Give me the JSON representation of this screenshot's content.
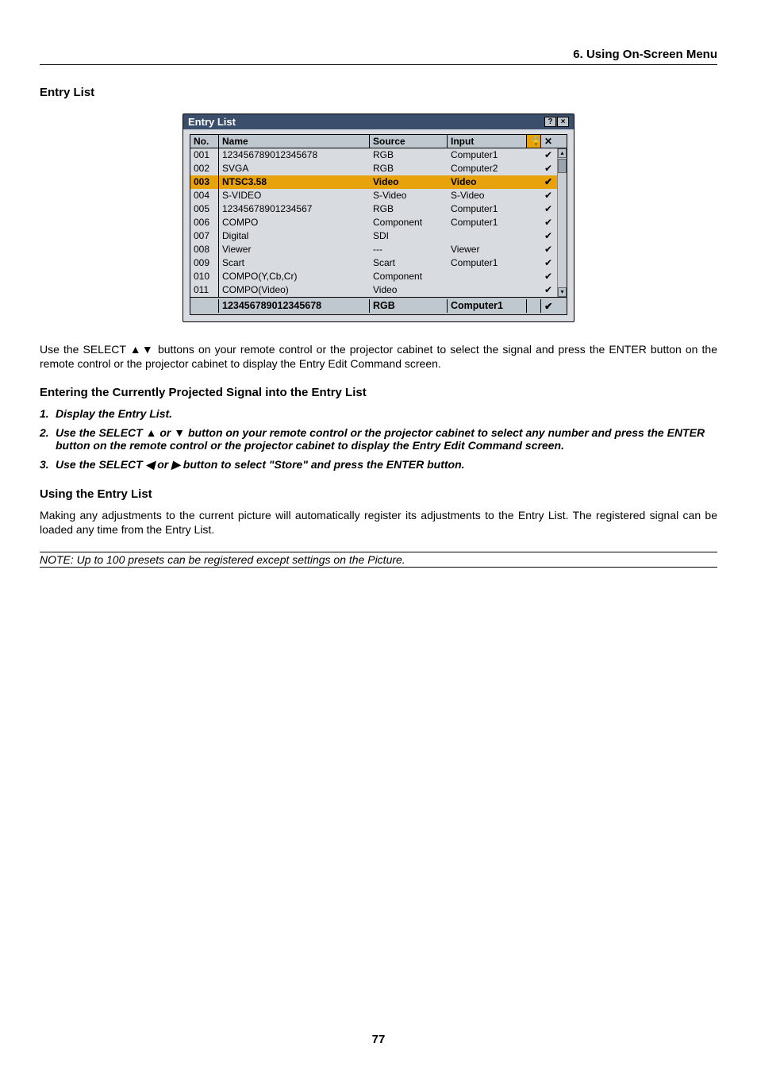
{
  "chapter": "6. Using On-Screen Menu",
  "section_title": "Entry List",
  "dialog": {
    "title": "Entry List",
    "headers": {
      "no": "No.",
      "name": "Name",
      "source": "Source",
      "input": "Input"
    },
    "rows": [
      {
        "no": "001",
        "name": "123456789012345678",
        "source": "RGB",
        "input": "Computer1",
        "check": true,
        "hl": false
      },
      {
        "no": "002",
        "name": "SVGA",
        "source": "RGB",
        "input": "Computer2",
        "check": true,
        "hl": false
      },
      {
        "no": "003",
        "name": "NTSC3.58",
        "source": "Video",
        "input": "Video",
        "check": true,
        "hl": true
      },
      {
        "no": "004",
        "name": "S-VIDEO",
        "source": "S-Video",
        "input": "S-Video",
        "check": true,
        "hl": false
      },
      {
        "no": "005",
        "name": "12345678901234567",
        "source": "RGB",
        "input": "Computer1",
        "check": true,
        "hl": false
      },
      {
        "no": "006",
        "name": "COMPO",
        "source": "Component",
        "input": "Computer1",
        "check": true,
        "hl": false
      },
      {
        "no": "007",
        "name": "Digital",
        "source": "SDI",
        "input": "",
        "check": true,
        "hl": false
      },
      {
        "no": "008",
        "name": "Viewer",
        "source": "---",
        "input": "Viewer",
        "check": true,
        "hl": false
      },
      {
        "no": "009",
        "name": "Scart",
        "source": "Scart",
        "input": "Computer1",
        "check": true,
        "hl": false
      },
      {
        "no": "010",
        "name": "COMPO(Y,Cb,Cr)",
        "source": "Component",
        "input": "",
        "check": true,
        "hl": false
      },
      {
        "no": "011",
        "name": "COMPO(Video)",
        "source": "Video",
        "input": "",
        "check": true,
        "hl": false
      }
    ],
    "status": {
      "name": "123456789012345678",
      "source": "RGB",
      "input": "Computer1",
      "check": true
    }
  },
  "paragraph1": "Use the SELECT ▲▼ buttons on your remote control or the projector cabinet to select the signal and press the ENTER button on the remote control or the projector cabinet to display the Entry Edit Command screen.",
  "sub1": "Entering the Currently Projected Signal into the Entry List",
  "steps": [
    {
      "n": "1.",
      "t": "Display the Entry List."
    },
    {
      "n": "2.",
      "t": "Use the SELECT ▲ or ▼ button on your remote control or the projector cabinet to select any number and press the ENTER button on the remote control or the projector cabinet to display the Entry Edit Command screen."
    },
    {
      "n": "3.",
      "t": "Use the SELECT ◀ or ▶ button to select \"Store\" and press the ENTER button."
    }
  ],
  "sub2": "Using the Entry List",
  "paragraph2": "Making any adjustments to the current picture will automatically register its adjustments to the Entry List. The registered signal can be loaded any time from the Entry List.",
  "note": "NOTE: Up to 100 presets can be registered except settings on the Picture.",
  "page_number": "77"
}
